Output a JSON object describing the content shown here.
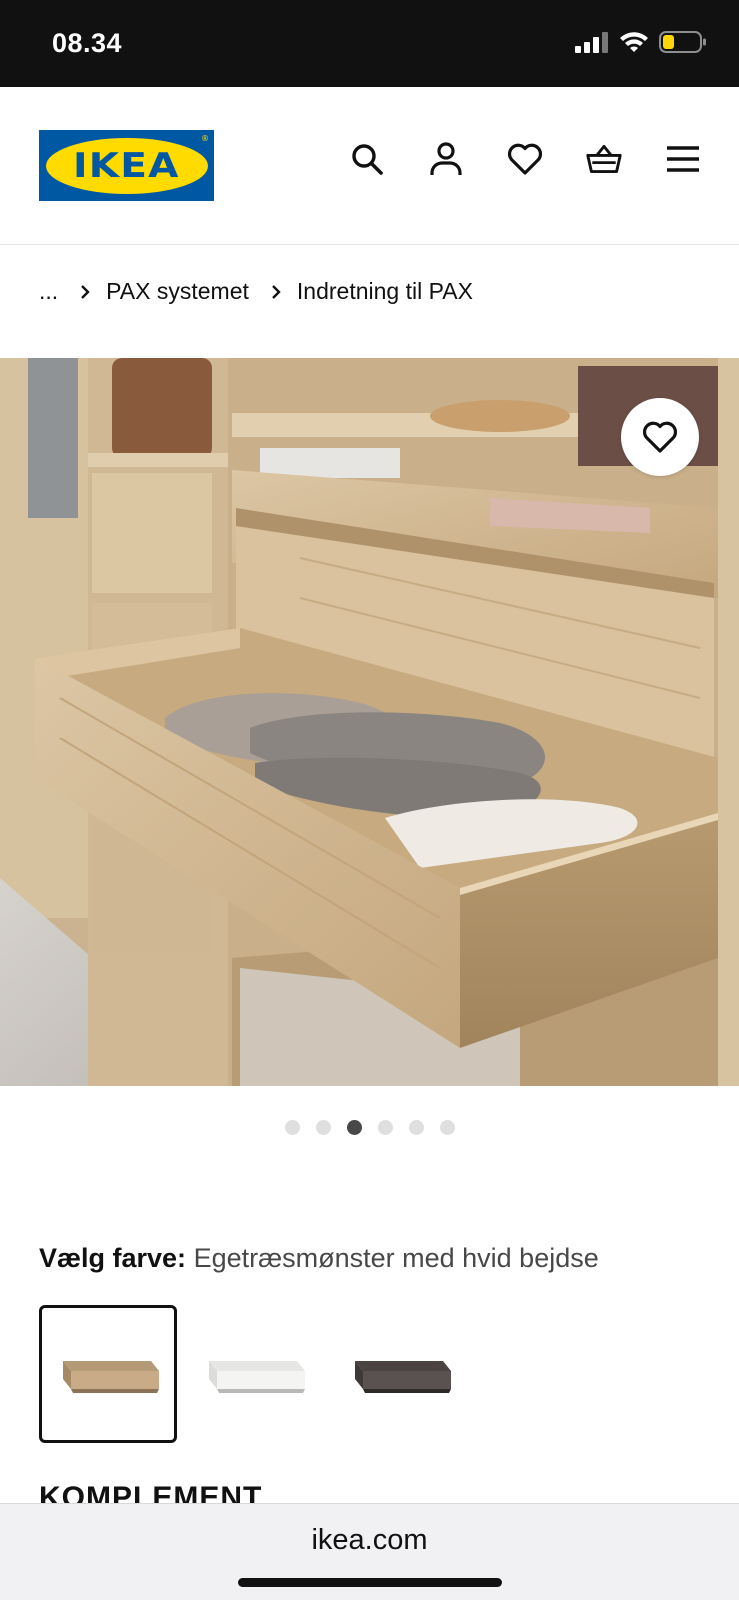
{
  "status_bar": {
    "time": "08.34",
    "battery_color": "#ffd60a"
  },
  "header": {
    "logo_text": "IKEA",
    "logo_colors": {
      "blue": "#0058a3",
      "yellow": "#ffdb00"
    },
    "icons": [
      "search-icon",
      "account-icon",
      "heart-icon",
      "basket-icon",
      "menu-icon"
    ]
  },
  "breadcrumb": {
    "items": [
      "...",
      "PAX systemet",
      "Indretning til PAX"
    ]
  },
  "gallery": {
    "image_description": "Open wooden drawer with folded clothes in a PAX wardrobe",
    "dot_count": 6,
    "active_dot": 3
  },
  "color_choice": {
    "label": "Vælg farve:",
    "value": "Egetræsmønster med hvid bejdse",
    "swatches": [
      {
        "name": "Egetræsmønster med hvid bejdse",
        "color": "#c9ab88",
        "selected": true
      },
      {
        "name": "Hvid",
        "color": "#f4f4f2",
        "selected": false
      },
      {
        "name": "Mørkebrun",
        "color": "#5a5250",
        "selected": false
      }
    ]
  },
  "section": {
    "title": "KOMPLEMENT"
  },
  "browser": {
    "url": "ikea.com"
  }
}
